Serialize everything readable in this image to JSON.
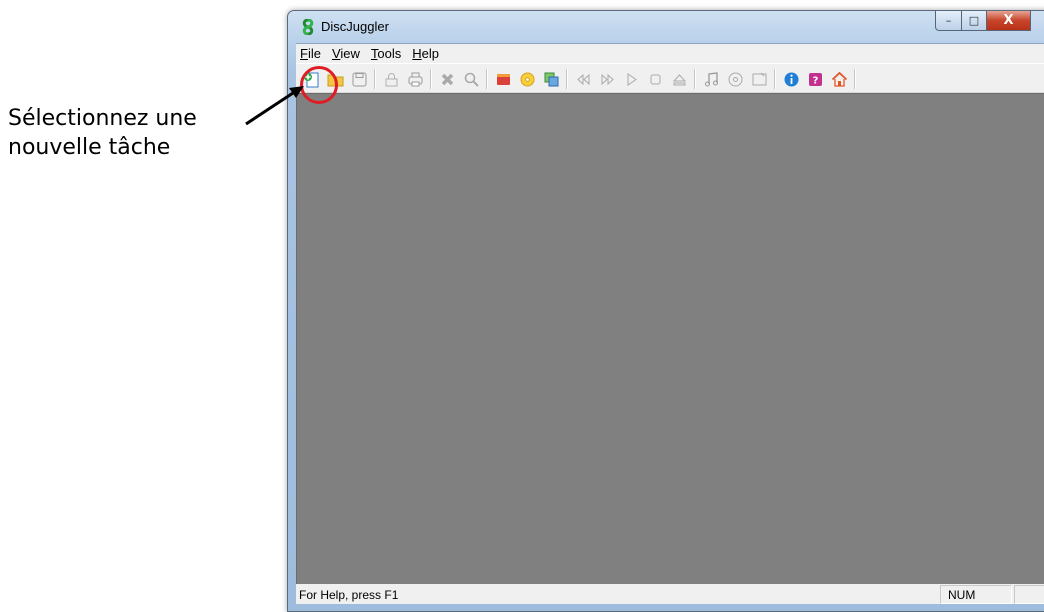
{
  "annotation": {
    "lines": [
      "Sélectionnez une",
      "nouvelle tâche"
    ]
  },
  "window": {
    "title": "DiscJuggler",
    "caption_buttons": {
      "minimize": "–",
      "maximize": "□",
      "close": "X"
    }
  },
  "menu": [
    {
      "label": "File",
      "mnemonic": "F",
      "rest": "ile"
    },
    {
      "label": "View",
      "mnemonic": "V",
      "rest": "iew"
    },
    {
      "label": "Tools",
      "mnemonic": "T",
      "rest": "ools"
    },
    {
      "label": "Help",
      "mnemonic": "H",
      "rest": "elp"
    }
  ],
  "toolbar": [
    "new-task-icon",
    "open-folder-icon",
    "save-icon",
    "lock-icon",
    "print-icon",
    "delete-icon",
    "search-icon",
    "wizard-icon",
    "disc-icon",
    "copy-disc-icon",
    "rewind-icon",
    "fast-forward-icon",
    "play-icon",
    "stop-icon",
    "eject-icon",
    "audio-track-icon",
    "disc-info-icon",
    "properties-icon",
    "info-icon",
    "help-icon",
    "home-icon"
  ],
  "statusbar": {
    "text": "For Help, press F1",
    "num": "NUM"
  },
  "colors": {
    "highlight_ring": "#e01c24",
    "workspace": "#808080"
  }
}
